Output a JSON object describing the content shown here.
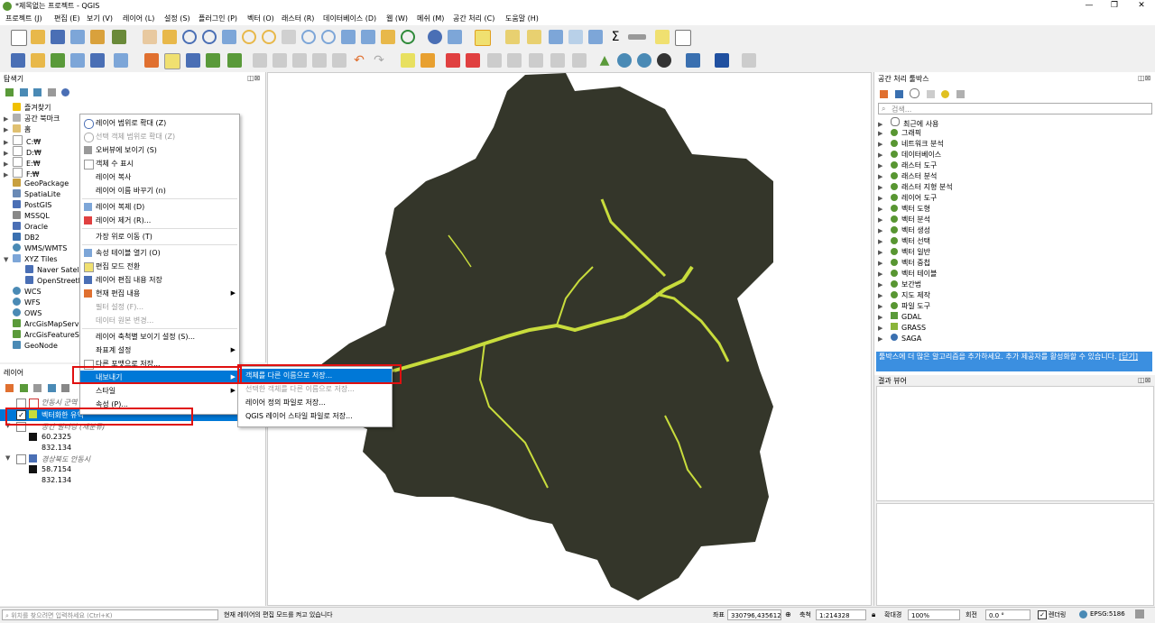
{
  "window": {
    "title": "*제목없는 프로젝트 - QGIS",
    "controls": [
      "—",
      "❐",
      "✕"
    ]
  },
  "menu": [
    "프로젝트 (J)",
    "편집 (E)",
    "보기 (V)",
    "레이어 (L)",
    "설정 (S)",
    "플러그인 (P)",
    "벡터 (O)",
    "래스터 (R)",
    "데이터베이스 (D)",
    "웹 (W)",
    "메쉬 (M)",
    "공간 처리 (C)",
    "도움말 (H)"
  ],
  "browser": {
    "title": "탐색기",
    "items": [
      "즐겨찾기",
      "공간 북마크",
      "홈",
      "C:₩",
      "D:₩",
      "E:₩",
      "F:₩",
      "GeoPackage",
      "SpatiaLite",
      "PostGIS",
      "MSSQL",
      "Oracle",
      "DB2",
      "WMS/WMTS",
      "XYZ Tiles",
      "Naver Satellite",
      "OpenStreetMap",
      "WCS",
      "WFS",
      "OWS",
      "ArcGisMapServer",
      "ArcGisFeatureServer",
      "GeoNode"
    ]
  },
  "layers": {
    "title": "레이어",
    "rows": [
      {
        "name": "안동시 군역",
        "checked": false
      },
      {
        "name": "벡터화한 유역",
        "checked": true
      },
      {
        "name": "공간 필터링 (재분류)",
        "checked": false
      }
    ],
    "legend1": {
      "v1": "60.2325",
      "v2": "832.134"
    },
    "layer2": {
      "name": "경상북도 안동시"
    },
    "legend2": {
      "v1": "58.7154",
      "v2": "832.134"
    }
  },
  "context_menu": {
    "items": [
      "레이어 범위로 확대 (Z)",
      "선택 객체 범위로 확대 (Z)",
      "오버뷰에 보이기 (S)",
      "객체 수 표시",
      "레이어 복사",
      "레이어 이름 바꾸기 (n)",
      "레이어 복제 (D)",
      "레이어 제거 (R)...",
      "가장 위로 이동 (T)",
      "속성 테이블 열기 (O)",
      "편집 모드 전환",
      "레이어 편집 내용 저장",
      "현재 편집 내용",
      "필터 설정 (F)...",
      "데이터 원본 변경...",
      "레이어 축척별 보이기 설정 (S)...",
      "좌표계 설정",
      "다른 포맷으로 저장...",
      "내보내기",
      "스타일",
      "속성 (P)..."
    ],
    "submenu": [
      "객체를 다른 이름으로 저장...",
      "선택한 객체를 다른 이름으로 저장...",
      "레이어 정의 파일로 저장...",
      "QGIS 레이어 스타일 파일로 저장..."
    ]
  },
  "toolbox": {
    "title": "공간 처리 툴박스",
    "search_placeholder": "검색...",
    "items": [
      "최근에 사용",
      "그래픽",
      "네트워크 분석",
      "데이터베이스",
      "래스터 도구",
      "래스터 분석",
      "래스터 지형 분석",
      "레이어 도구",
      "벡터 도형",
      "벡터 분석",
      "벡터 생성",
      "벡터 선택",
      "벡터 일반",
      "벡터 중첩",
      "벡터 테이블",
      "보간법",
      "지도 제작",
      "파일 도구",
      "GDAL",
      "GRASS",
      "SAGA"
    ],
    "info": "툴박스에 더 많은 알고리즘을 추가하세요. 추가 제공자를 활성화할 수 있습니다.",
    "info_close": "[닫기]"
  },
  "results": {
    "title": "결과 뷰어"
  },
  "status": {
    "locator_placeholder": "위치를 찾으려면 입력하세요 (Ctrl+K)",
    "message": "현재 레이어의 편집 모드를 켜고 있습니다",
    "coord_label": "좌표",
    "coord_value": "330796,435612",
    "scale_label": "축척",
    "scale_value": "1:214328",
    "mag_label": "확대경",
    "mag_value": "100%",
    "rot_label": "회전",
    "rot_value": "0.0 °",
    "render_label": "렌더링",
    "crs": "EPSG:5186"
  },
  "colors": {
    "map_fill": "#34362a",
    "water": "#c8dc3c",
    "highlight": "#0078d7",
    "red_box": "#e01010"
  }
}
